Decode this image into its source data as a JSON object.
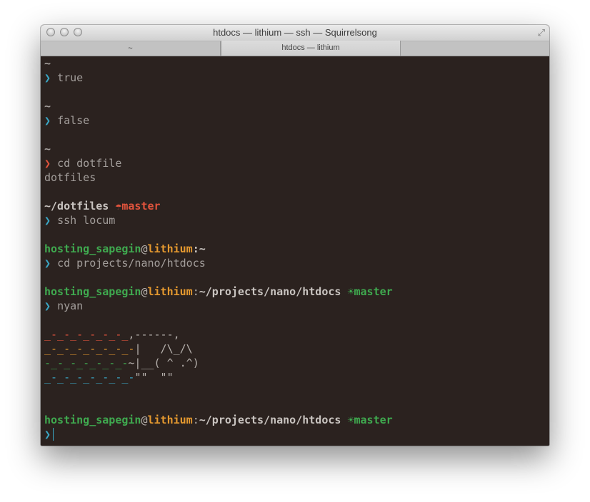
{
  "window": {
    "title": "htdocs — lithium — ssh — Squirrelsong",
    "fullscreen_icon": "⤢"
  },
  "tabs": [
    {
      "label": "~",
      "active": false
    },
    {
      "label": "htdocs — lithium",
      "active": true
    }
  ],
  "terminal": {
    "prompt_char": "❯",
    "tilde": "~",
    "cmd1": "true",
    "cmd2": "false",
    "cmd3": "cd dotfile",
    "output3": "dotfiles",
    "dotfiles_path": "~/dotfiles",
    "umbrella": "☂",
    "branch_master": "master",
    "cmd4": "ssh locum",
    "user": "hosting_sapegin",
    "at": "@",
    "host": "lithium",
    "colon_home": ":~",
    "cmd5": "cd projects/nano/htdocs",
    "path_colon": ":",
    "path": "~/projects/nano/htdocs",
    "sun": "☀",
    "cmd6": "nyan",
    "nyan": {
      "r1_trail": "_-_-_-_-_-_-_",
      "r1_body": ",------,",
      "r2_trail": "_-_-_-_-_-_-_-",
      "r2_body": "|   /\\_/\\",
      "r3_trail": "-_-_-_-_-_-_-",
      "r3_body": "~|__( ^ .^)",
      "r4_trail": "_-_-_-_-_-_-_-",
      "r4_body": "\"\"  \"\""
    }
  },
  "colors": {
    "background": "#2b221f",
    "prompt_ok": "#3aa6c4",
    "prompt_error": "#e0533c",
    "user_green": "#3fa94f",
    "host_orange": "#e5992f"
  }
}
